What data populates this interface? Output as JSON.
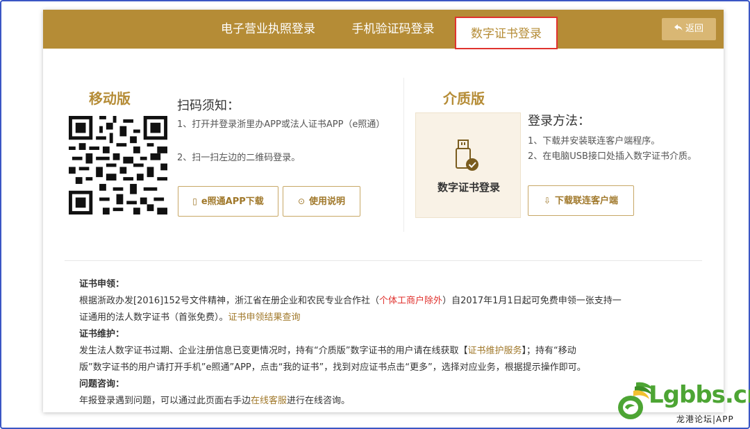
{
  "tabs": [
    {
      "label": "电子营业执照登录"
    },
    {
      "label": "手机验证码登录"
    },
    {
      "label": "数字证书登录"
    }
  ],
  "back_label": "返回",
  "mobile": {
    "title": "移动版",
    "scan_title": "扫码须知：",
    "items": [
      "1、打开并登录浙里办APP或法人证书APP（e照通）",
      "2、扫一扫左边的二维码登录。"
    ],
    "app_button": "e照通APP下载",
    "guide_button": "使用说明"
  },
  "media": {
    "title": "介质版",
    "card_label": "数字证书登录",
    "login_title": "登录方法：",
    "items": [
      "1、下载并安装联连客户端程序。",
      "2、在电脑USB接口处插入数字证书介质。"
    ],
    "client_button": "下载联连客户端"
  },
  "info": {
    "apply_heading": "证书申领：",
    "apply_text_1": "根据浙政办发[2016]152号文件精神，浙江省在册企业和农民专业合作社（",
    "apply_red": "个体工商户除外",
    "apply_text_2": "）自2017年1月1日起可免费申领一张支持一",
    "apply_text_3": "证通用的法人数字证书（首张免费）。",
    "apply_link": "证书申领结果查询",
    "maint_heading": "证书维护：",
    "maint_text_1": "发生法人数字证书过期、企业注册信息已变更情况时，持有“介质版”数字证书的用户请在线获取【",
    "maint_link": "证书维护服务",
    "maint_text_2": "】；持有“移动",
    "maint_text_3": "版”数字证书的用户请打开手机”e照通”APP，点击“我的证书”，找到对应证书点击“更多”，选择对应业务，根据提示操作即可。",
    "faq_heading": "问题咨询：",
    "faq_text_1": "年报登录遇到问题，可以通过此页面右手边",
    "faq_link": "在线客服",
    "faq_text_2": "进行在线咨询。"
  },
  "watermark": {
    "logo": "Lgbbs.cn",
    "sub": "龙港论坛|APP"
  },
  "colors": {
    "brand": "#b58c36",
    "highlight": "#e0322e"
  }
}
